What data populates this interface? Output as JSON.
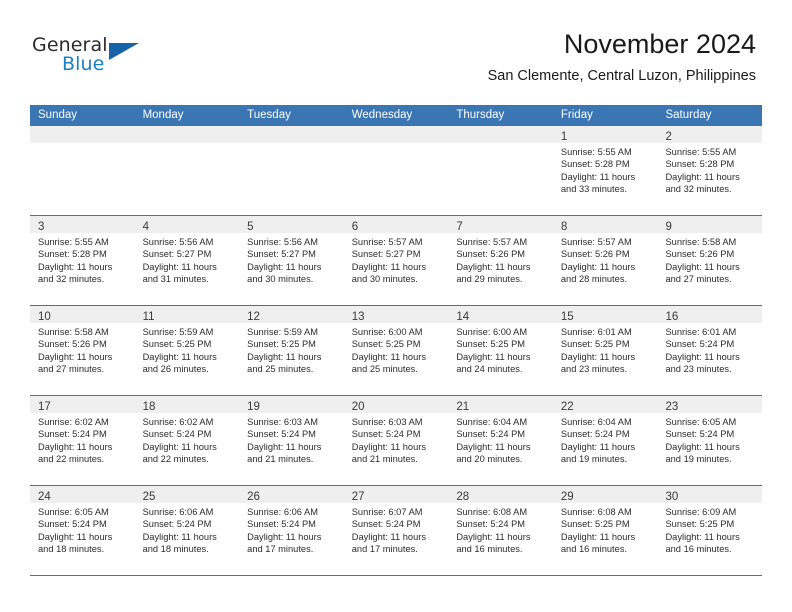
{
  "brand": {
    "name_part1": "General",
    "name_part2": "Blue",
    "flag_icon": "triangle-flag-icon"
  },
  "header": {
    "title": "November 2024",
    "subtitle": "San Clemente, Central Luzon, Philippines"
  },
  "colors": {
    "header_blue": "#3b76b4",
    "brand_blue": "#1d7fc4",
    "flag_blue": "#1763a8",
    "day_band_gray": "#efefef"
  },
  "weekdays": [
    "Sunday",
    "Monday",
    "Tuesday",
    "Wednesday",
    "Thursday",
    "Friday",
    "Saturday"
  ],
  "weeks": [
    [
      {
        "empty": true
      },
      {
        "empty": true
      },
      {
        "empty": true
      },
      {
        "empty": true
      },
      {
        "empty": true
      },
      {
        "day": "1",
        "sunrise": "Sunrise: 5:55 AM",
        "sunset": "Sunset: 5:28 PM",
        "daylight1": "Daylight: 11 hours",
        "daylight2": "and 33 minutes."
      },
      {
        "day": "2",
        "sunrise": "Sunrise: 5:55 AM",
        "sunset": "Sunset: 5:28 PM",
        "daylight1": "Daylight: 11 hours",
        "daylight2": "and 32 minutes."
      }
    ],
    [
      {
        "day": "3",
        "sunrise": "Sunrise: 5:55 AM",
        "sunset": "Sunset: 5:28 PM",
        "daylight1": "Daylight: 11 hours",
        "daylight2": "and 32 minutes."
      },
      {
        "day": "4",
        "sunrise": "Sunrise: 5:56 AM",
        "sunset": "Sunset: 5:27 PM",
        "daylight1": "Daylight: 11 hours",
        "daylight2": "and 31 minutes."
      },
      {
        "day": "5",
        "sunrise": "Sunrise: 5:56 AM",
        "sunset": "Sunset: 5:27 PM",
        "daylight1": "Daylight: 11 hours",
        "daylight2": "and 30 minutes."
      },
      {
        "day": "6",
        "sunrise": "Sunrise: 5:57 AM",
        "sunset": "Sunset: 5:27 PM",
        "daylight1": "Daylight: 11 hours",
        "daylight2": "and 30 minutes."
      },
      {
        "day": "7",
        "sunrise": "Sunrise: 5:57 AM",
        "sunset": "Sunset: 5:26 PM",
        "daylight1": "Daylight: 11 hours",
        "daylight2": "and 29 minutes."
      },
      {
        "day": "8",
        "sunrise": "Sunrise: 5:57 AM",
        "sunset": "Sunset: 5:26 PM",
        "daylight1": "Daylight: 11 hours",
        "daylight2": "and 28 minutes."
      },
      {
        "day": "9",
        "sunrise": "Sunrise: 5:58 AM",
        "sunset": "Sunset: 5:26 PM",
        "daylight1": "Daylight: 11 hours",
        "daylight2": "and 27 minutes."
      }
    ],
    [
      {
        "day": "10",
        "sunrise": "Sunrise: 5:58 AM",
        "sunset": "Sunset: 5:26 PM",
        "daylight1": "Daylight: 11 hours",
        "daylight2": "and 27 minutes."
      },
      {
        "day": "11",
        "sunrise": "Sunrise: 5:59 AM",
        "sunset": "Sunset: 5:25 PM",
        "daylight1": "Daylight: 11 hours",
        "daylight2": "and 26 minutes."
      },
      {
        "day": "12",
        "sunrise": "Sunrise: 5:59 AM",
        "sunset": "Sunset: 5:25 PM",
        "daylight1": "Daylight: 11 hours",
        "daylight2": "and 25 minutes."
      },
      {
        "day": "13",
        "sunrise": "Sunrise: 6:00 AM",
        "sunset": "Sunset: 5:25 PM",
        "daylight1": "Daylight: 11 hours",
        "daylight2": "and 25 minutes."
      },
      {
        "day": "14",
        "sunrise": "Sunrise: 6:00 AM",
        "sunset": "Sunset: 5:25 PM",
        "daylight1": "Daylight: 11 hours",
        "daylight2": "and 24 minutes."
      },
      {
        "day": "15",
        "sunrise": "Sunrise: 6:01 AM",
        "sunset": "Sunset: 5:25 PM",
        "daylight1": "Daylight: 11 hours",
        "daylight2": "and 23 minutes."
      },
      {
        "day": "16",
        "sunrise": "Sunrise: 6:01 AM",
        "sunset": "Sunset: 5:24 PM",
        "daylight1": "Daylight: 11 hours",
        "daylight2": "and 23 minutes."
      }
    ],
    [
      {
        "day": "17",
        "sunrise": "Sunrise: 6:02 AM",
        "sunset": "Sunset: 5:24 PM",
        "daylight1": "Daylight: 11 hours",
        "daylight2": "and 22 minutes."
      },
      {
        "day": "18",
        "sunrise": "Sunrise: 6:02 AM",
        "sunset": "Sunset: 5:24 PM",
        "daylight1": "Daylight: 11 hours",
        "daylight2": "and 22 minutes."
      },
      {
        "day": "19",
        "sunrise": "Sunrise: 6:03 AM",
        "sunset": "Sunset: 5:24 PM",
        "daylight1": "Daylight: 11 hours",
        "daylight2": "and 21 minutes."
      },
      {
        "day": "20",
        "sunrise": "Sunrise: 6:03 AM",
        "sunset": "Sunset: 5:24 PM",
        "daylight1": "Daylight: 11 hours",
        "daylight2": "and 21 minutes."
      },
      {
        "day": "21",
        "sunrise": "Sunrise: 6:04 AM",
        "sunset": "Sunset: 5:24 PM",
        "daylight1": "Daylight: 11 hours",
        "daylight2": "and 20 minutes."
      },
      {
        "day": "22",
        "sunrise": "Sunrise: 6:04 AM",
        "sunset": "Sunset: 5:24 PM",
        "daylight1": "Daylight: 11 hours",
        "daylight2": "and 19 minutes."
      },
      {
        "day": "23",
        "sunrise": "Sunrise: 6:05 AM",
        "sunset": "Sunset: 5:24 PM",
        "daylight1": "Daylight: 11 hours",
        "daylight2": "and 19 minutes."
      }
    ],
    [
      {
        "day": "24",
        "sunrise": "Sunrise: 6:05 AM",
        "sunset": "Sunset: 5:24 PM",
        "daylight1": "Daylight: 11 hours",
        "daylight2": "and 18 minutes."
      },
      {
        "day": "25",
        "sunrise": "Sunrise: 6:06 AM",
        "sunset": "Sunset: 5:24 PM",
        "daylight1": "Daylight: 11 hours",
        "daylight2": "and 18 minutes."
      },
      {
        "day": "26",
        "sunrise": "Sunrise: 6:06 AM",
        "sunset": "Sunset: 5:24 PM",
        "daylight1": "Daylight: 11 hours",
        "daylight2": "and 17 minutes."
      },
      {
        "day": "27",
        "sunrise": "Sunrise: 6:07 AM",
        "sunset": "Sunset: 5:24 PM",
        "daylight1": "Daylight: 11 hours",
        "daylight2": "and 17 minutes."
      },
      {
        "day": "28",
        "sunrise": "Sunrise: 6:08 AM",
        "sunset": "Sunset: 5:24 PM",
        "daylight1": "Daylight: 11 hours",
        "daylight2": "and 16 minutes."
      },
      {
        "day": "29",
        "sunrise": "Sunrise: 6:08 AM",
        "sunset": "Sunset: 5:25 PM",
        "daylight1": "Daylight: 11 hours",
        "daylight2": "and 16 minutes."
      },
      {
        "day": "30",
        "sunrise": "Sunrise: 6:09 AM",
        "sunset": "Sunset: 5:25 PM",
        "daylight1": "Daylight: 11 hours",
        "daylight2": "and 16 minutes."
      }
    ]
  ]
}
